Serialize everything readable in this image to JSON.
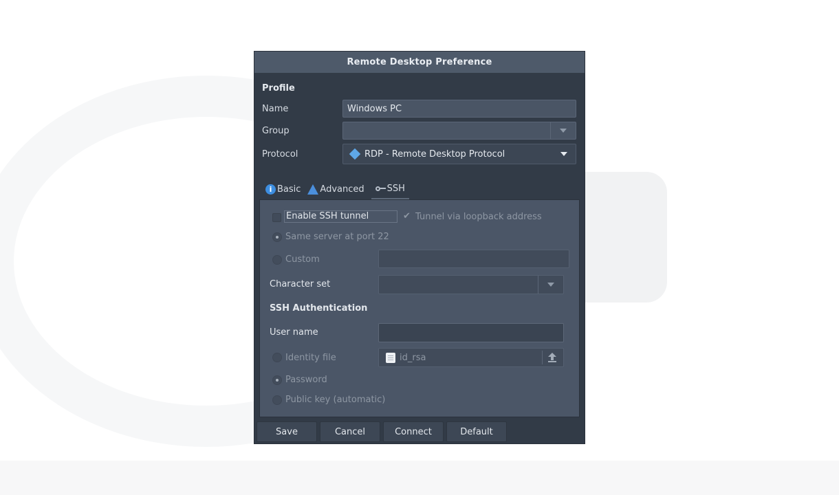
{
  "window": {
    "title": "Remote Desktop Preference"
  },
  "profile": {
    "section_title": "Profile",
    "name_label": "Name",
    "name_value": "Windows PC",
    "group_label": "Group",
    "group_value": "",
    "protocol_label": "Protocol",
    "protocol_value": "RDP - Remote Desktop Protocol"
  },
  "tabs": [
    {
      "label": "Basic",
      "icon": "info-icon"
    },
    {
      "label": "Advanced",
      "icon": "warning-icon"
    },
    {
      "label": "SSH",
      "icon": "key-icon",
      "active": true
    }
  ],
  "ssh": {
    "enable_tunnel_label": "Enable SSH tunnel",
    "enable_tunnel_checked": false,
    "loopback_label": "Tunnel via loopback address",
    "loopback_checked": true,
    "same_server_label": "Same server at port 22",
    "custom_label": "Custom",
    "custom_value": "",
    "charset_label": "Character set",
    "charset_value": "",
    "auth_title": "SSH Authentication",
    "username_label": "User name",
    "username_value": "",
    "identity_label": "Identity file",
    "identity_value": "id_rsa",
    "password_label": "Password",
    "pubkey_label": "Public key (automatic)"
  },
  "buttons": {
    "save": "Save",
    "cancel": "Cancel",
    "connect": "Connect",
    "default": "Default"
  },
  "colors": {
    "window_bg": "#323b47",
    "titlebar_bg": "#4e5a6a",
    "panel_bg": "#4b5667",
    "accent_blue": "#3d8ee0"
  }
}
